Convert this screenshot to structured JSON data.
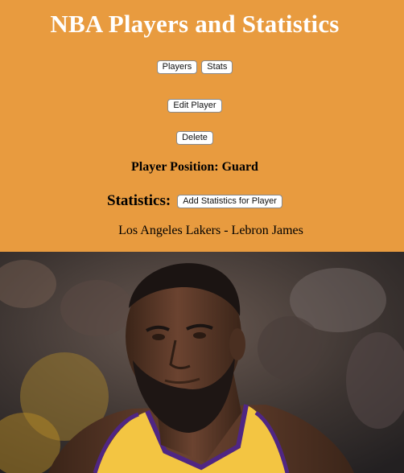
{
  "header": {
    "title": "NBA Players and Statistics"
  },
  "nav": {
    "players_label": "Players",
    "stats_label": "Stats"
  },
  "actions": {
    "edit_label": "Edit Player",
    "delete_label": "Delete"
  },
  "player": {
    "position_text": "Player Position: Guard",
    "team_and_name": "Los Angeles Lakers - Lebron James"
  },
  "statistics": {
    "label": "Statistics:",
    "add_button_label": "Add Statistics for Player"
  },
  "colors": {
    "page_background": "#E89B3F",
    "title_text": "#FFFFFF",
    "jersey_yellow": "#F3C542",
    "jersey_purple": "#4F2683"
  }
}
